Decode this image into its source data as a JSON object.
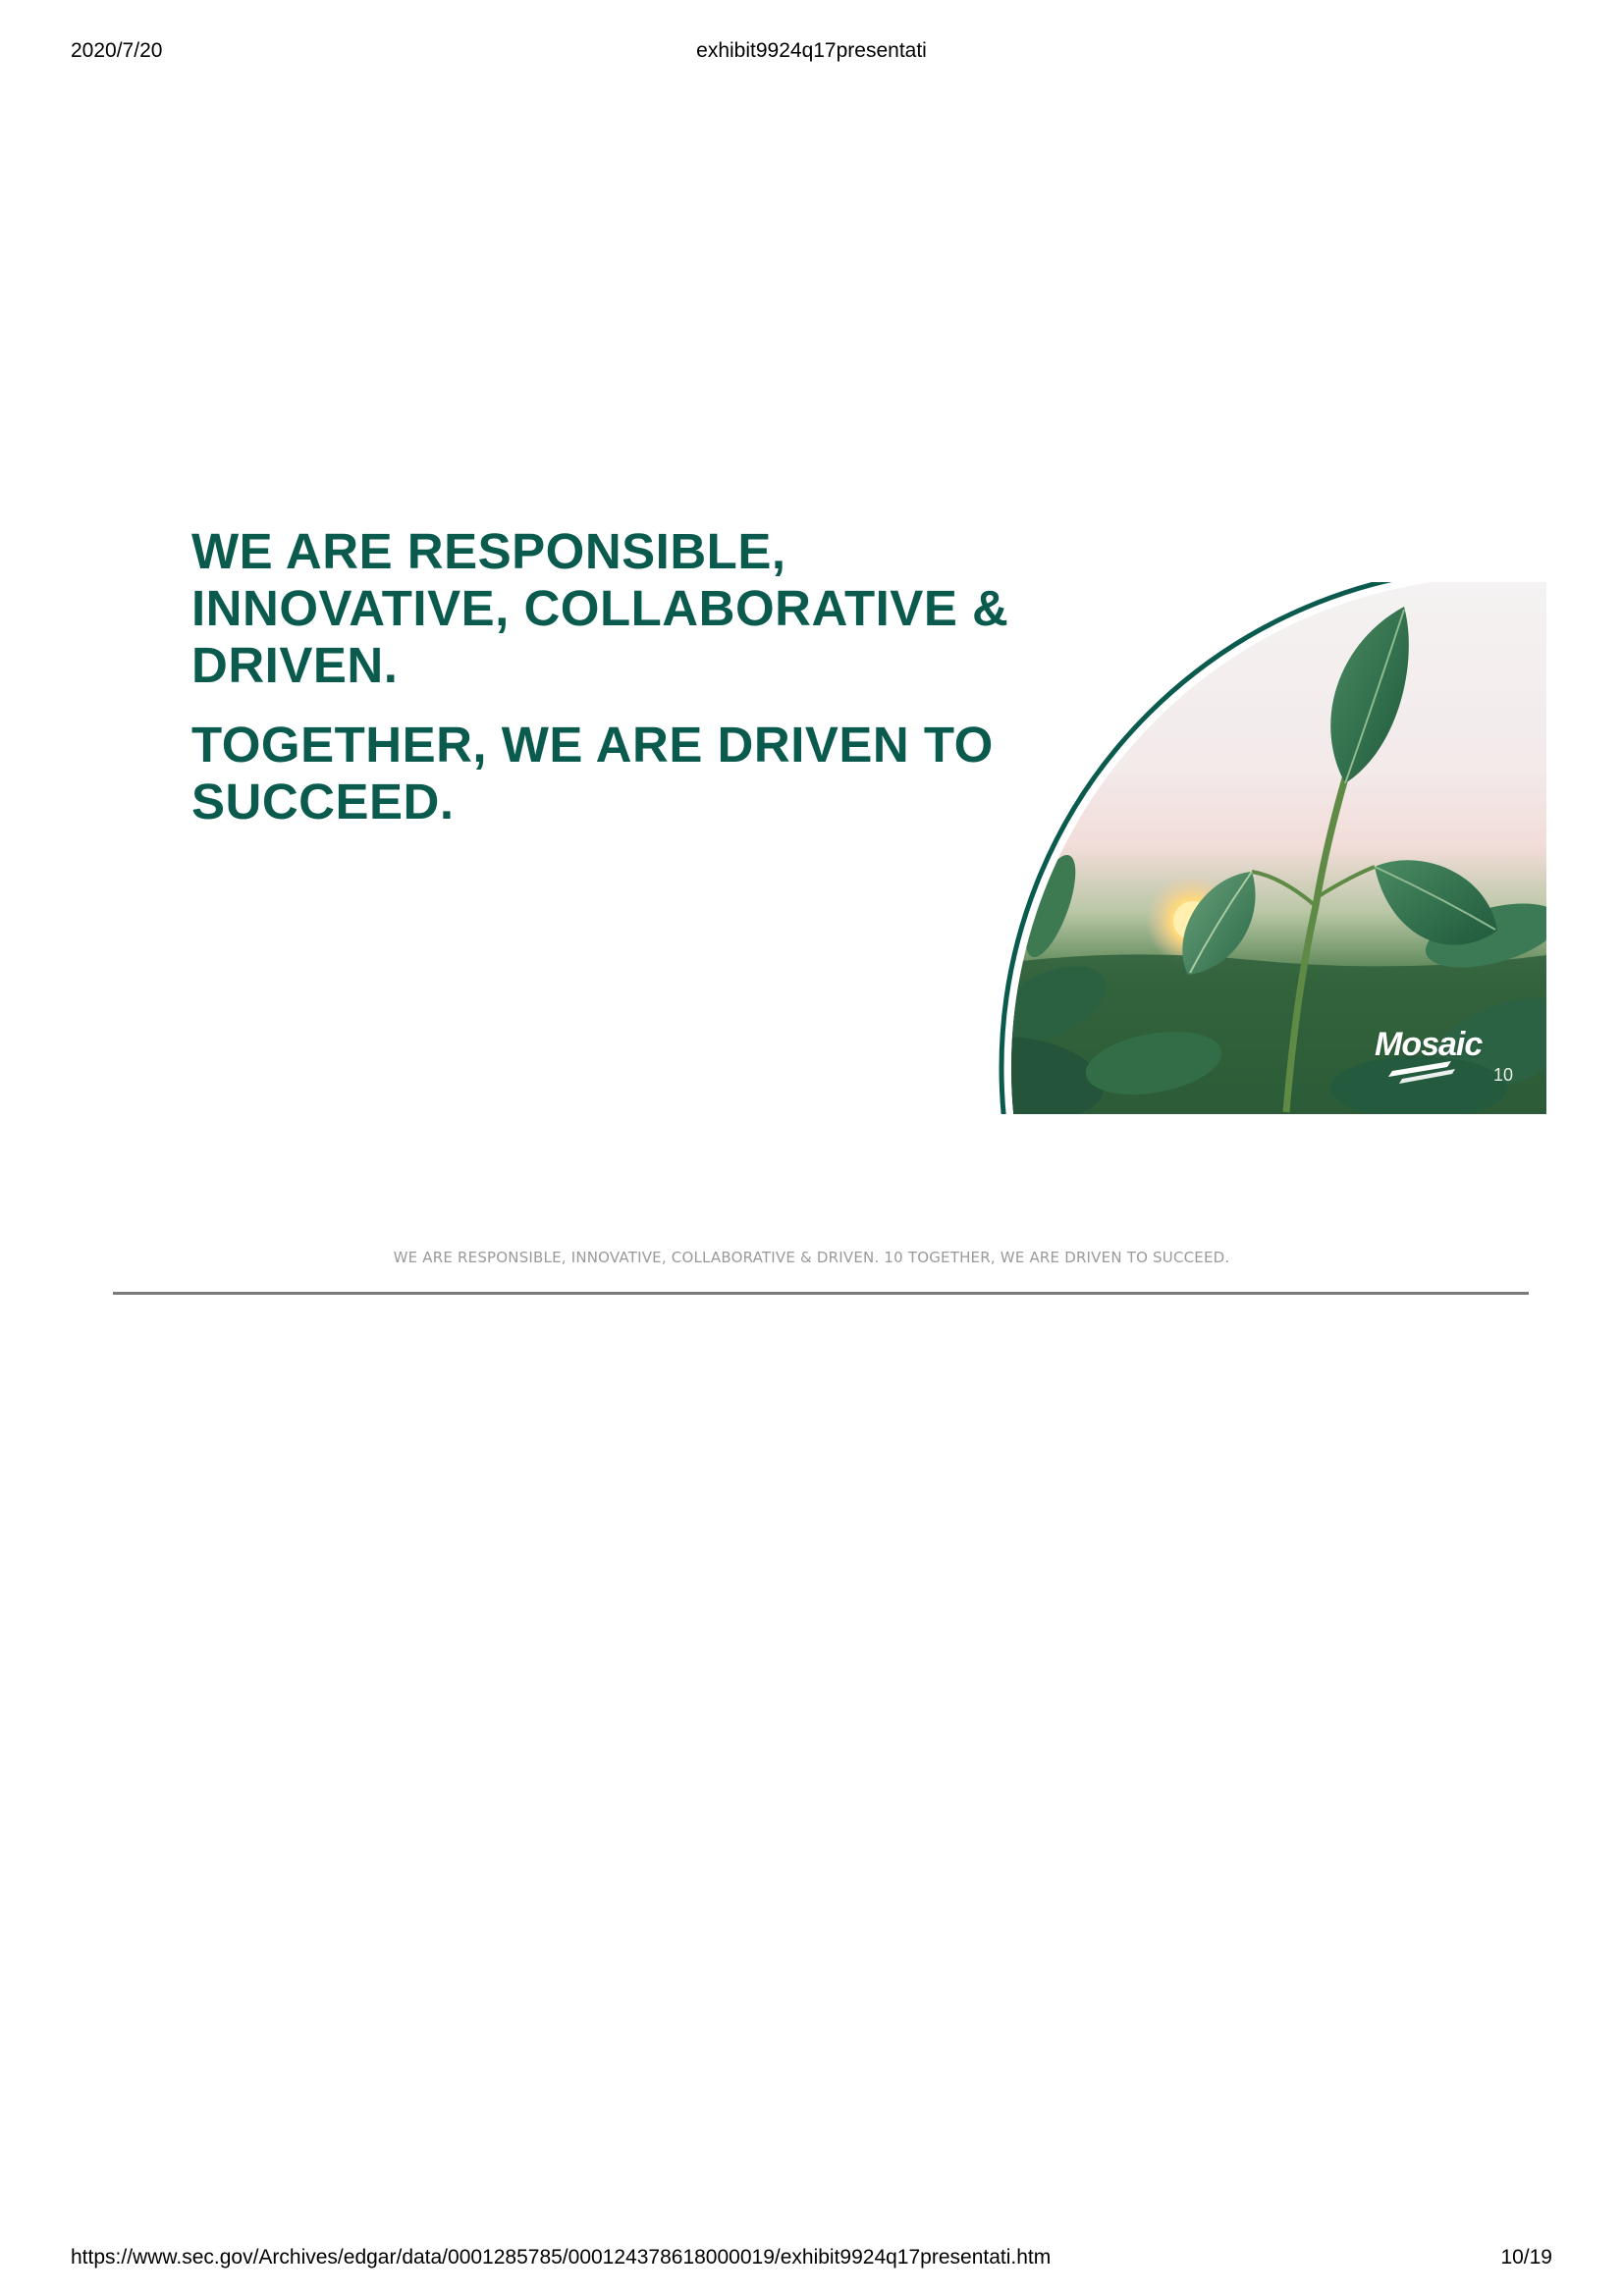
{
  "print_header": {
    "date": "2020/7/20",
    "title": "exhibit9924q17presentati"
  },
  "slide": {
    "headline_1": "WE ARE RESPONSIBLE, INNOVATIVE, COLLABORATIVE & DRIVEN.",
    "headline_2": "TOGETHER, WE ARE DRIVEN TO SUCCEED.",
    "logo_text": "Mosaic",
    "slide_number": "10",
    "colors": {
      "headline": "#0a5b4e",
      "arc": "#0a5b4e",
      "leaf": "#2f6b4c",
      "sky": "#f2eeee"
    },
    "image": "soybean-leaves-at-sunset"
  },
  "caption": "WE ARE RESPONSIBLE, INNOVATIVE, COLLABORATIVE & DRIVEN. 10 TOGETHER, WE ARE DRIVEN TO SUCCEED.",
  "print_footer": {
    "url": "https://www.sec.gov/Archives/edgar/data/0001285785/000124378618000019/exhibit9924q17presentati.htm",
    "page": "10/19"
  }
}
